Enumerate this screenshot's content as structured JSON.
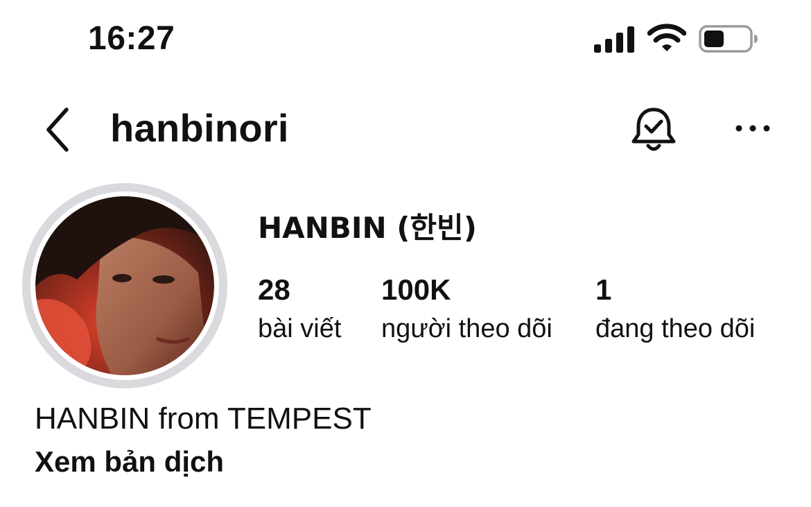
{
  "status_bar": {
    "time": "16:27",
    "icons": [
      "signal-icon",
      "wifi-icon",
      "battery-icon"
    ]
  },
  "header": {
    "username": "hanbinori",
    "icons": [
      "back-icon",
      "bell-check-icon",
      "more-options-icon"
    ]
  },
  "profile": {
    "display_name": "HANBIN (한빈)",
    "stats": [
      {
        "value": "28",
        "label": "bài viết"
      },
      {
        "value": "100K",
        "label": "người theo dõi"
      },
      {
        "value": "1",
        "label": "đang theo dõi"
      }
    ],
    "bio": "HANBIN from TEMPEST",
    "translate_label": "Xem bản dịch"
  },
  "colors": {
    "text": "#111111",
    "avatar_ring": "#d9d9de",
    "background": "#ffffff"
  }
}
